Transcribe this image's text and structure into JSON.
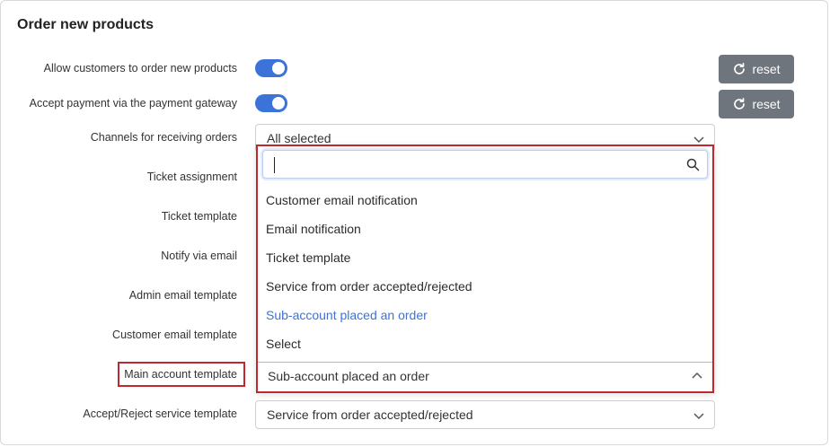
{
  "section": {
    "title": "Order new products"
  },
  "rows": {
    "allow_order": {
      "label": "Allow customers to order new products",
      "enabled": true
    },
    "accept_payment": {
      "label": "Accept payment via the payment gateway",
      "enabled": true
    },
    "channels": {
      "label": "Channels for receiving orders",
      "value": "All selected"
    },
    "ticket_assignment": {
      "label": "Ticket assignment"
    },
    "ticket_template": {
      "label": "Ticket template"
    },
    "notify_email": {
      "label": "Notify via email"
    },
    "admin_email_template": {
      "label": "Admin email template"
    },
    "customer_email_template": {
      "label": "Customer email template"
    },
    "main_account_template": {
      "label": "Main account template",
      "value": "Sub-account placed an order"
    },
    "accept_reject_template": {
      "label": "Accept/Reject service template",
      "value": "Service from order accepted/rejected"
    }
  },
  "reset_label": "reset",
  "dropdown": {
    "search_value": "",
    "options": [
      "Customer email notification",
      "Email notification",
      "Ticket template",
      "Service from order accepted/rejected",
      "Sub-account placed an order",
      "Select"
    ],
    "active_index": 4
  },
  "colors": {
    "accent": "#3b73d9",
    "highlight": "#c0282d",
    "button": "#6e757c"
  },
  "icons": {
    "reset": "refresh-icon",
    "search": "search-icon",
    "chevron": "chevron-down-icon"
  }
}
